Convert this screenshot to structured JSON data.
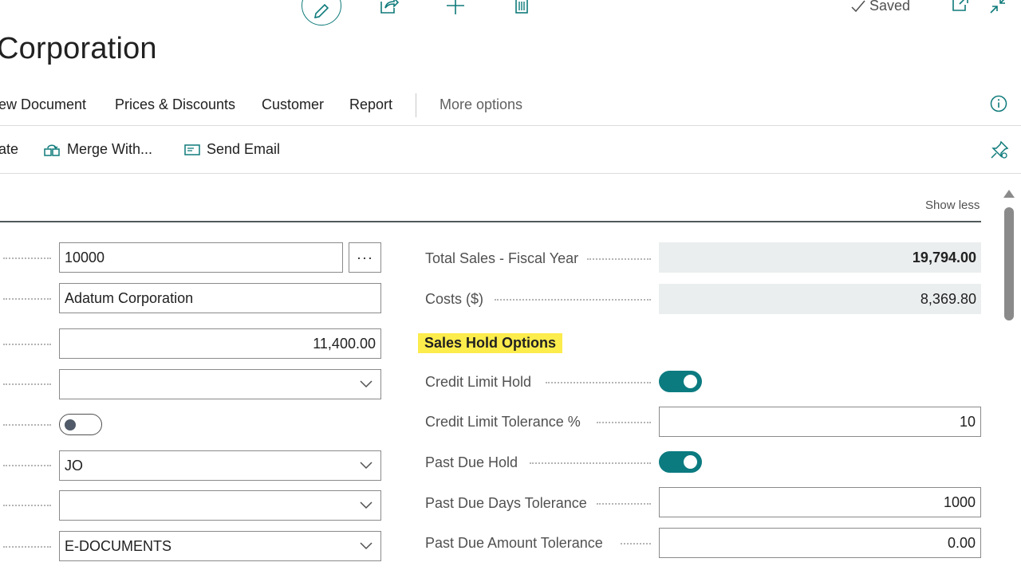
{
  "header": {
    "saved_label": "Saved",
    "title": "Corporation"
  },
  "menu": {
    "items": [
      "ew Document",
      "Prices & Discounts",
      "Customer",
      "Report"
    ],
    "more_options": "More options"
  },
  "subactions": {
    "items": [
      "ate",
      "Merge With...",
      "Send Email"
    ]
  },
  "section": {
    "show_less": "Show less"
  },
  "left_fields": {
    "number": "10000",
    "ellipsis": "···",
    "name": "Adatum Corporation",
    "amount": "11,400.00",
    "select_empty_1": "",
    "toggle_state": "off",
    "code": "JO",
    "select_empty_2": "",
    "doc_type": "E-DOCUMENTS"
  },
  "right_fields": {
    "total_sales_label": "Total Sales - Fiscal Year",
    "total_sales_value": "19,794.00",
    "costs_label": "Costs ($)",
    "costs_value": "8,369.80",
    "hold_title": "Sales Hold Options",
    "credit_limit_hold_label": "Credit Limit Hold",
    "credit_limit_hold": "on",
    "credit_limit_tolerance_label": "Credit Limit Tolerance %",
    "credit_limit_tolerance_value": "10",
    "past_due_hold_label": "Past Due Hold",
    "past_due_hold": "on",
    "past_due_days_label": "Past Due Days Tolerance",
    "past_due_days_value": "1000",
    "past_due_amount_label": "Past Due Amount Tolerance",
    "past_due_amount_value": "0.00"
  },
  "colors": {
    "accent": "#0b7b80",
    "highlight": "#fcec4c",
    "readonly_bg": "#ebeeef"
  }
}
